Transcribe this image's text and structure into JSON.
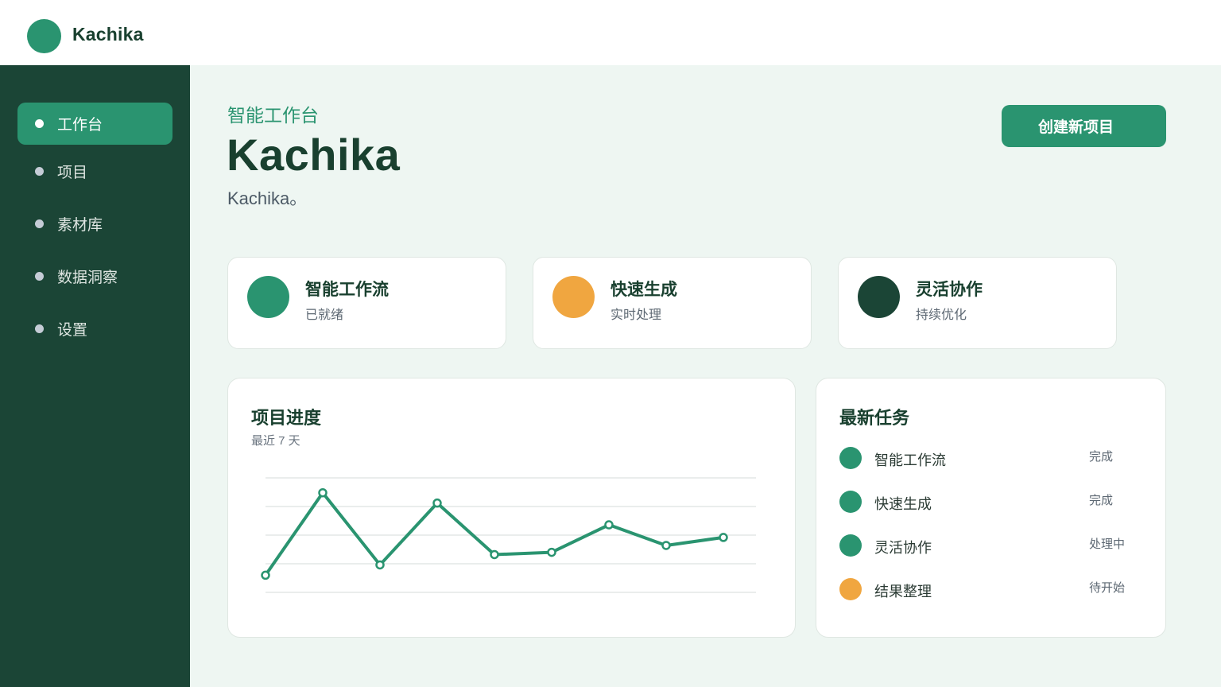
{
  "header": {
    "brand": "Kachika"
  },
  "colors": {
    "primary": "#2a9470",
    "dark": "#1b4536",
    "accent": "#f0a640",
    "deep": "#1b4536",
    "background": "#eef6f2"
  },
  "sidebar": {
    "items": [
      {
        "label": "工作台",
        "active": true
      },
      {
        "label": "项目",
        "active": false
      },
      {
        "label": "素材库",
        "active": false
      },
      {
        "label": "数据洞察",
        "active": false
      },
      {
        "label": "设置",
        "active": false
      }
    ]
  },
  "hero": {
    "eyebrow": "智能工作台",
    "title": "Kachika",
    "subtitle": "Kachika。",
    "create_button": "创建新项目"
  },
  "features": [
    {
      "title": "智能工作流",
      "subtitle": "已就绪",
      "color": "#2a9470"
    },
    {
      "title": "快速生成",
      "subtitle": "实时处理",
      "color": "#f0a640"
    },
    {
      "title": "灵活协作",
      "subtitle": "持续优化",
      "color": "#1b4536"
    }
  ],
  "progress": {
    "title": "项目进度",
    "subtitle": "最近 7 天"
  },
  "chart_data": {
    "type": "line",
    "x": [
      1,
      2,
      3,
      4,
      5,
      6,
      7,
      8,
      9
    ],
    "series": [
      {
        "values": [
          15,
          87,
          24,
          78,
          33,
          35,
          59,
          41,
          48
        ]
      }
    ],
    "ylim": [
      0,
      100
    ],
    "grid": true,
    "color": "#2a9470"
  },
  "tasks": {
    "title": "最新任务",
    "items": [
      {
        "name": "智能工作流",
        "status": "完成",
        "color": "#2a9470"
      },
      {
        "name": "快速生成",
        "status": "完成",
        "color": "#2a9470"
      },
      {
        "name": "灵活协作",
        "status": "处理中",
        "color": "#2a9470"
      },
      {
        "name": "结果整理",
        "status": "待开始",
        "color": "#f0a640"
      }
    ]
  }
}
